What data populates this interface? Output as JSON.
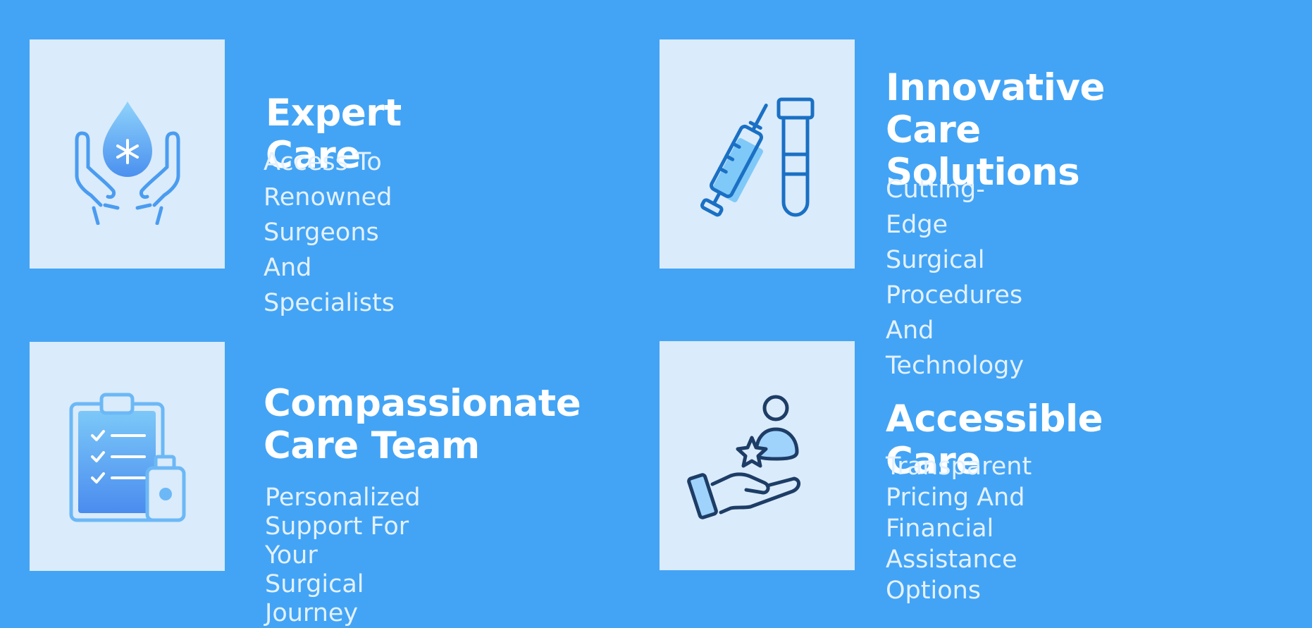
{
  "features": [
    {
      "title": "Expert Care",
      "description": "Access To Renowned\nSurgeons And Specialists",
      "icon": "hands-blood-drop-icon"
    },
    {
      "title": "Innovative Care\nSolutions",
      "description": "Cutting-Edge Surgical\nProcedures And  Technology",
      "icon": "syringe-test-tube-icon"
    },
    {
      "title": "Compassionate\nCare Team",
      "description": "Personalized Support For\nYour Surgical Journey",
      "icon": "clipboard-medicine-bottle-icon"
    },
    {
      "title": "Accessible Care",
      "description": "Transparent Pricing And\nFinancial Assistance Options",
      "icon": "hand-person-star-icon"
    }
  ],
  "colors": {
    "background": "#43a4f5",
    "icon_box": "#daebfb",
    "title": "#ffffff",
    "description": "#e4f1fd",
    "icon_dark": "#1a70c4",
    "icon_navy": "#1d3d66",
    "icon_light": "#9fd3fb"
  }
}
